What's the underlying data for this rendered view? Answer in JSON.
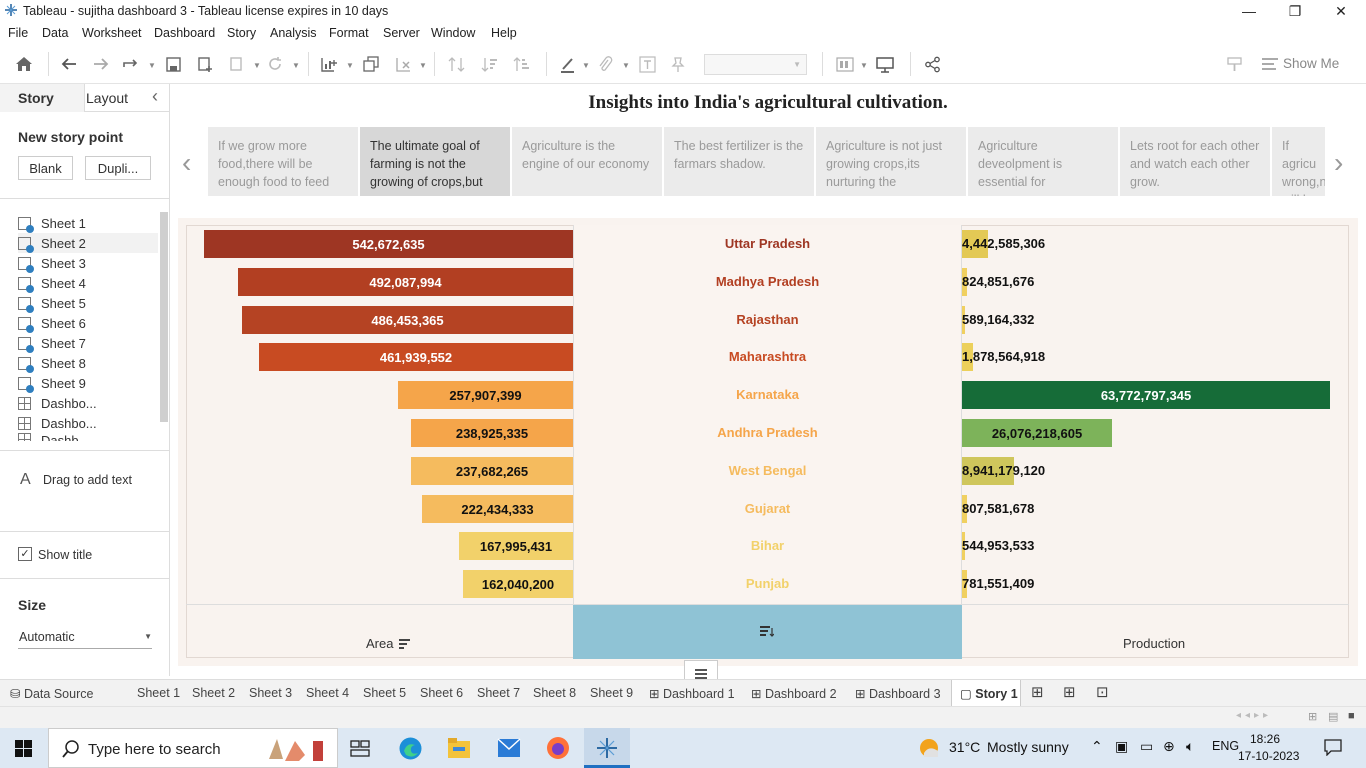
{
  "window": {
    "title": "Tableau - sujitha dashboard 3 - Tableau license expires in 10 days",
    "minimize": "—",
    "restore": "❐",
    "close": "✕"
  },
  "menu": [
    "File",
    "Data",
    "Worksheet",
    "Dashboard",
    "Story",
    "Analysis",
    "Format",
    "Server",
    "Window",
    "Help"
  ],
  "toolbar": {
    "show_me": "Show Me"
  },
  "left_pane": {
    "tab_story": "Story",
    "tab_layout": "Layout",
    "collapse": "‹",
    "new_story_point": "New story point",
    "blank_button": "Blank",
    "duplicate_button": "Dupli...",
    "sheets": [
      "Sheet 1",
      "Sheet 2",
      "Sheet 3",
      "Sheet 4",
      "Sheet 5",
      "Sheet 6",
      "Sheet 7",
      "Sheet 8",
      "Sheet 9",
      "Dashbo...",
      "Dashbo...",
      "Dashb..."
    ],
    "drag_text": "Drag to add text",
    "text_icon": "A",
    "show_title": "Show title",
    "size_label": "Size",
    "size_value": "Automatic"
  },
  "story": {
    "title": "Insights into India's agricultural cultivation.",
    "prev": "‹",
    "next": "›",
    "points": [
      "If we grow more food,there will be enough food to feed",
      "The ultimate goal of farming is not the growing of crops,but",
      "Agriculture is the engine of our economy",
      "The best fertilizer is the farmars shadow.",
      "Agriculture is not just growing crops,its nurturing the",
      "Agriculture deveolpment is essential for",
      "Lets root for each other and watch each other grow.",
      "If agricu wrong,n will hav"
    ]
  },
  "chart_data": {
    "type": "bar",
    "categories": [
      "Uttar Pradesh",
      "Madhya Pradesh",
      "Rajasthan",
      "Maharashtra",
      "Karnataka",
      "Andhra Pradesh",
      "West Bengal",
      "Gujarat",
      "Bihar",
      "Punjab"
    ],
    "series": [
      {
        "name": "Area",
        "values": [
          542672635,
          492087994,
          486453365,
          461939552,
          257907399,
          238925335,
          237682265,
          222434333,
          167995431,
          162040200
        ],
        "labels": [
          "542,672,635",
          "492,087,994",
          "486,453,365",
          "461,939,552",
          "257,907,399",
          "238,925,335",
          "237,682,265",
          "222,434,333",
          "167,995,431",
          "162,040,200"
        ],
        "colors": [
          "#9e3623",
          "#b23f22",
          "#b54323",
          "#c84b22",
          "#f5a54a",
          "#f5a54a",
          "#f5bb5e",
          "#f5bb5e",
          "#f2d16a",
          "#f2d16a"
        ],
        "label_colors": [
          "#ffffff",
          "#ffffff",
          "#ffffff",
          "#ffffff",
          "#111111",
          "#111111",
          "#111111",
          "#111111",
          "#111111",
          "#111111"
        ]
      },
      {
        "name": "Production",
        "values": [
          4442585306,
          824851676,
          589164332,
          1878564918,
          63772797345,
          26076218605,
          8941179120,
          807581678,
          544953533,
          781551409
        ],
        "labels": [
          "4,442,585,306",
          "824,851,676",
          "589,164,332",
          "1,878,564,918",
          "63,772,797,345",
          "26,076,218,605",
          "8,941,179,120",
          "807,581,678",
          "544,953,533",
          "781,551,409"
        ],
        "colors": [
          "#e3c955",
          "#f0d060",
          "#f0d060",
          "#ecd05b",
          "#166c38",
          "#7db35a",
          "#cfc65c",
          "#f0d060",
          "#f0d060",
          "#f0d060"
        ],
        "label_colors": [
          "#111111",
          "#111111",
          "#111111",
          "#111111",
          "#ffffff",
          "#111111",
          "#111111",
          "#111111",
          "#111111",
          "#111111"
        ]
      }
    ],
    "state_label_colors": [
      "#9e3623",
      "#b23f22",
      "#b54323",
      "#c84b22",
      "#f5a54a",
      "#f5a54a",
      "#f5bb5e",
      "#f5bb5e",
      "#f2d16a",
      "#f2d16a"
    ],
    "axis_titles": {
      "left": "Area",
      "right": "Production"
    }
  },
  "sheet_tabs": [
    "Data Source",
    "Sheet 1",
    "Sheet 2",
    "Sheet 3",
    "Sheet 4",
    "Sheet 5",
    "Sheet 6",
    "Sheet 7",
    "Sheet 8",
    "Sheet 9",
    "Dashboard 1",
    "Dashboard 2",
    "Dashboard 3",
    "Story 1"
  ],
  "taskbar": {
    "search_placeholder": "Type here to search",
    "weather_temp": "31°C",
    "weather_text": "Mostly sunny",
    "lang": "ENG",
    "time": "18:26",
    "date": "17-10-2023"
  }
}
